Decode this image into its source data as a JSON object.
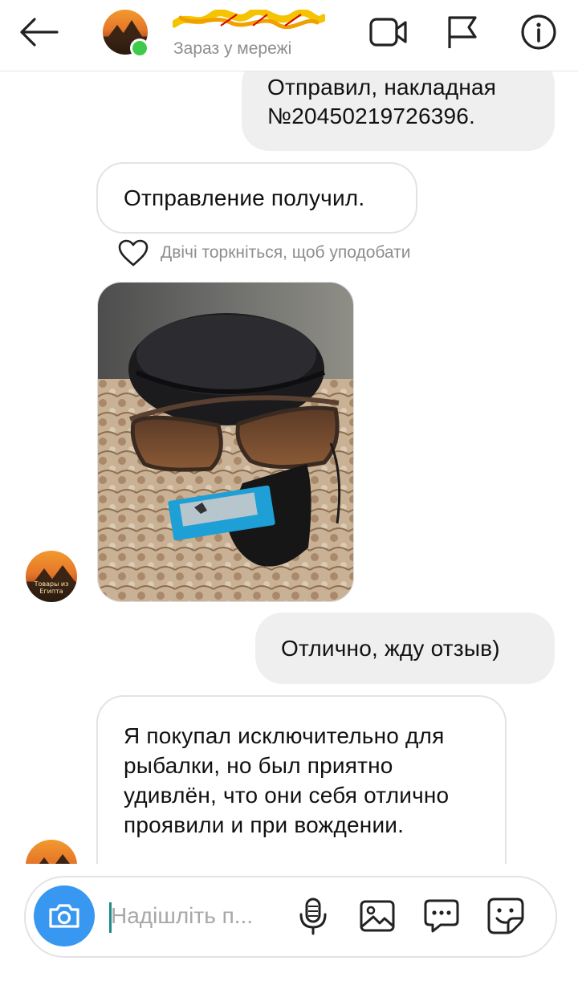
{
  "header": {
    "status": "Зараз у мережі",
    "icons": [
      "back-arrow-icon",
      "video-call-icon",
      "flag-icon",
      "info-icon"
    ]
  },
  "messages": [
    {
      "dir": "out",
      "text": "Отправил, накладная №20450219726396."
    },
    {
      "dir": "in",
      "text": "Отправление получил."
    },
    {
      "dir": "meta",
      "text": "Двічі торкніться, щоб уподобати"
    },
    {
      "dir": "in",
      "type": "photo",
      "icon": "sunglasses-photo"
    },
    {
      "dir": "out",
      "text": "Отлично, жду отзыв)"
    },
    {
      "dir": "in",
      "text": "Я покупал исключительно для рыбалки, но был приятно удивлён, что они себя отлично проявили и при вождении."
    }
  ],
  "avatar_label": "Товары из Египта",
  "composer": {
    "placeholder": "Надішліть п...",
    "icons": [
      "camera-icon",
      "microphone-icon",
      "gallery-icon",
      "chat-bubble-icon",
      "sticker-icon"
    ]
  },
  "colors": {
    "accent": "#3897f0",
    "online": "#3ecb4b",
    "bubble_out": "#efefef",
    "meta_text": "#8e8e8e"
  }
}
